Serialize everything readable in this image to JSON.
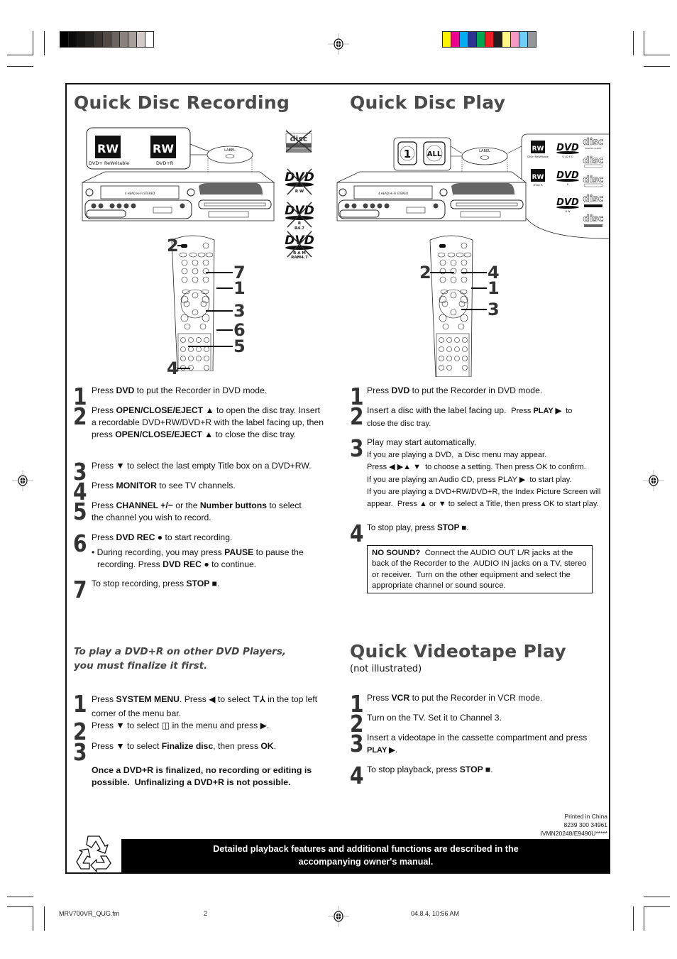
{
  "colors": {
    "heading": "#4a4a4a",
    "step_number": "#333333",
    "footer_bg": "#000000",
    "footer_text": "#ffffff",
    "gray_swatches": [
      "#000000",
      "#0a0a0a",
      "#181513",
      "#26211f",
      "#3a3330",
      "#524a46",
      "#6b625f",
      "#8a817e",
      "#a79f9c",
      "#d3cbca",
      "#ffffff"
    ],
    "color_swatches": [
      "#fff200",
      "#ec008c",
      "#00aeef",
      "#2e3192",
      "#00a651",
      "#ed1c24",
      "#231f20",
      "#fff685",
      "#f49ac2",
      "#6dcff6",
      "#939598"
    ]
  },
  "recording": {
    "title": "Quick Disc Recording",
    "labels": {
      "disc1": "DVD+ ReWritable",
      "disc2": "DVD+R",
      "rw": "RW",
      "label": "LABEL",
      "cd_top": "COMPACT",
      "cd_main": "disc",
      "cd_rw": "ReWritable",
      "dvd": "DVD",
      "dvd_rw": "R W",
      "dvd_r": "R",
      "dvd_r_cap": "R4.7",
      "dvd_ram": "R A M",
      "dvd_ram_cap": "RAM4.7"
    },
    "callouts": [
      "2",
      "7",
      "1",
      "3",
      "6",
      "5",
      "4"
    ],
    "steps": [
      {
        "n": "1",
        "html": "Press <b>DVD</b> to put the Recorder in DVD mode."
      },
      {
        "n": "2",
        "html": "Press <b>OPEN/CLOSE/EJECT ▲</b> to open the disc tray. Insert a recordable DVD+RW/DVD+R with the label facing up, then press <b>OPEN/CLOSE/EJECT ▲</b> to close the disc tray."
      },
      {
        "n": "3",
        "html": "Press ▼ to select the last empty Title box on a DVD+RW."
      },
      {
        "n": "4",
        "html": "Press <b>MONITOR</b> to see TV channels."
      },
      {
        "n": "5",
        "html": "Press <b>CHANNEL +/−</b> or the <b>Number buttons</b> to select the channel you wish to record."
      },
      {
        "n": "6",
        "html": "Press <b>DVD REC ●</b> to start recording."
      },
      {
        "n": "7",
        "html": "To stop recording, press <b>STOP ■</b>."
      }
    ],
    "step6_bullet": "• During recording, you may press <b>PAUSE</b> to pause the recording. Press <b>DVD REC ●</b> to continue."
  },
  "play": {
    "title": "Quick Disc Play",
    "labels": {
      "region1": "1",
      "region_all": "ALL",
      "disc1": "DVD+ReWritable",
      "disc2": "DVD+R",
      "dvd_video": "V I D E O",
      "dvd_r": "R",
      "dvd_rw": "R W",
      "cd_sub1": "DIGITAL AUDIO",
      "cd_sub2": "SUPER VIDEO",
      "cd_sub3": "DIGITAL VIDEO",
      "cd_sub4": "Recordable",
      "cd_sub5": "ReWritable"
    },
    "callouts": [
      "2",
      "4",
      "1",
      "3"
    ],
    "steps": [
      {
        "n": "1",
        "html": "Press <b>DVD</b> to put the Recorder in DVD mode."
      },
      {
        "n": "2",
        "html": "Insert a disc with the label facing up.&nbsp; <span style='font-size:11px'>Press <b>PLAY ▶</b>&nbsp; to</span><br><span style='font-size:11px'>close the disc tray.</span>"
      },
      {
        "n": "3",
        "html": "Play may start automatically.<br><span style='font-size:11px;line-height:15.3px'>If you are playing a DVD,&nbsp; a Disc menu may appear.<br>Press ◀ ▶▲ ▼&nbsp; to choose a setting. Then press OK to confirm.<br>If you are playing an Audio CD, press PLAY ▶&nbsp; to start play.<br>If you are playing a DVD+RW/DVD+R, the Index Picture Screen will appear.&nbsp; Press ▲ or ▼ to select a Title, then press OK to start play.</span>"
      },
      {
        "n": "4",
        "html": "<span style='font-size:11.6px'>To stop play, press <b>STOP ■</b>.</span>"
      }
    ],
    "no_sound": "<b>NO SOUND?</b>&nbsp; Connect the AUDIO OUT L/R jacks at the back of the Recorder to the&nbsp; AUDIO IN jacks on a TV, stereo or receiver.&nbsp; Turn on the other equipment and select the appropriate channel or sound source."
  },
  "finalize": {
    "heading_line1": "To play a DVD+R on other DVD Players,",
    "heading_line2": "you must finalize it first.",
    "steps": [
      {
        "n": "1",
        "html": "Press <b>SYSTEM MENU</b>. Press ◀ to select <span style='font-weight:bold'>⊤⅄</span> in the top left corner of the menu bar."
      },
      {
        "n": "2",
        "html": "Press ▼ to select &#9707; in the menu and press ▶."
      },
      {
        "n": "3",
        "html": "Press ▼ to select <b>Finalize disc</b>, then press <b>OK</b>."
      }
    ],
    "warning": "Once a DVD+R is finalized, no recording or editing is possible.&nbsp; Unfinalizing a DVD+R is not possible."
  },
  "videotape": {
    "title": "Quick Videotape Play",
    "subtitle": "(not illustrated)",
    "steps": [
      {
        "n": "1",
        "html": "Press <b>VCR</b> to put the Recorder in VCR mode."
      },
      {
        "n": "2",
        "html": "Turn on the TV. Set it to Channel 3."
      },
      {
        "n": "3",
        "html": "Insert a videotape in the cassette compartment and press <b style='font-size:11px'>PLAY ▶</b>."
      },
      {
        "n": "4",
        "html": "To stop playback, press <b>STOP ■</b>."
      }
    ]
  },
  "printed": {
    "line1": "Printed in China",
    "line2": "8239 300 34961",
    "line3": "IVMN20248/E9490U*****"
  },
  "footer": {
    "line1": "Detailed playback features and additional functions are described in the",
    "line2": "accompanying owner's manual."
  },
  "slug": {
    "file": "MRV700VR_QUG.fm",
    "page": "2",
    "datetime": "04.8.4, 10:56 AM"
  }
}
